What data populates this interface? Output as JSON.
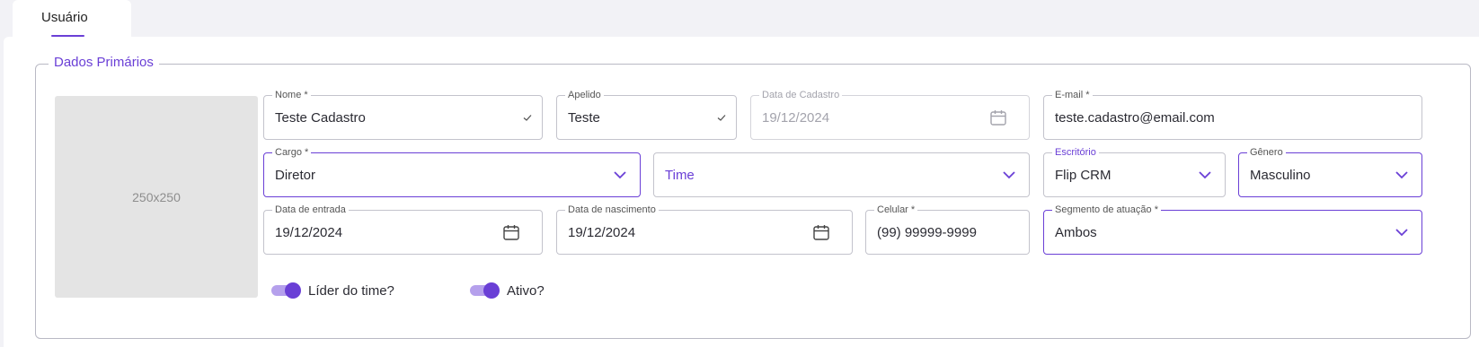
{
  "tabs": [
    {
      "label": "Usuário"
    }
  ],
  "section": {
    "title": "Dados Primários"
  },
  "avatar": {
    "placeholder": "250x250"
  },
  "fields": {
    "nome": {
      "label": "Nome *",
      "value": "Teste Cadastro"
    },
    "apelido": {
      "label": "Apelido",
      "value": "Teste"
    },
    "data_cadastro": {
      "label": "Data de Cadastro",
      "value": "19/12/2024"
    },
    "email": {
      "label": "E-mail *",
      "value": "teste.cadastro@email.com"
    },
    "cargo": {
      "label": "Cargo *",
      "value": "Diretor"
    },
    "time": {
      "label": "",
      "placeholder": "Time"
    },
    "escritorio": {
      "label": "Escritório",
      "value": "Flip CRM"
    },
    "genero": {
      "label": "Gênero",
      "value": "Masculino"
    },
    "data_entrada": {
      "label": "Data de entrada",
      "value": "19/12/2024"
    },
    "data_nascimento": {
      "label": "Data de nascimento",
      "value": "19/12/2024"
    },
    "celular": {
      "label": "Celular *",
      "value": "(99) 99999-9999"
    },
    "segmento": {
      "label": "Segmento de atuação *",
      "value": "Ambos"
    }
  },
  "toggles": {
    "lider": {
      "label": "Líder do time?",
      "checked": true
    },
    "ativo": {
      "label": "Ativo?",
      "checked": true
    }
  },
  "colors": {
    "accent": "#6a3fd6",
    "accent_light": "#b5a0ec",
    "border": "#c3c3cc"
  }
}
